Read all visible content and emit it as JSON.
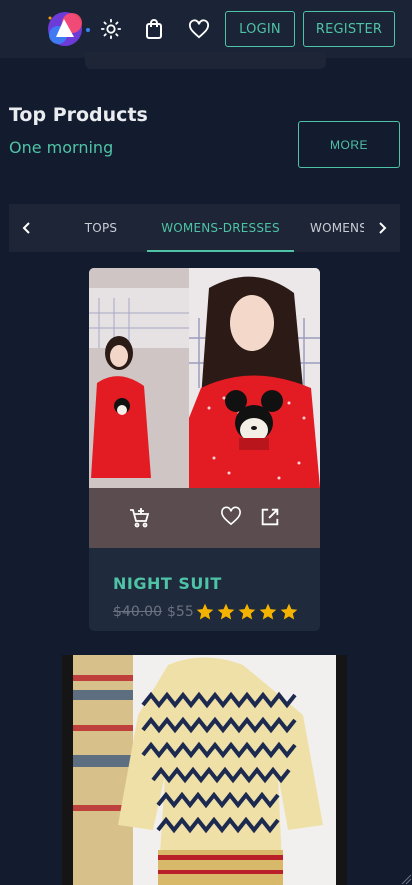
{
  "header": {
    "login_label": "LOGIN",
    "register_label": "REGISTER",
    "icons": [
      "brand-logo",
      "sun-icon",
      "bag-icon",
      "heart-icon"
    ]
  },
  "section": {
    "title": "Top Products",
    "subtitle": "One morning",
    "more_label": "MORE"
  },
  "tabs": {
    "items": [
      {
        "label": "TOPS",
        "active": false
      },
      {
        "label": "WOMENS-DRESSES",
        "active": true
      },
      {
        "label": "WOMENS",
        "active": false
      }
    ]
  },
  "products": [
    {
      "name": "NIGHT SUIT",
      "old_price": "$40.00",
      "new_price": "$55",
      "rating": 5,
      "rating_max": 5
    },
    {
      "name": ""
    }
  ],
  "colors": {
    "accent": "#4ec3a6",
    "star": "#f5b301",
    "background": "#131b2e"
  }
}
